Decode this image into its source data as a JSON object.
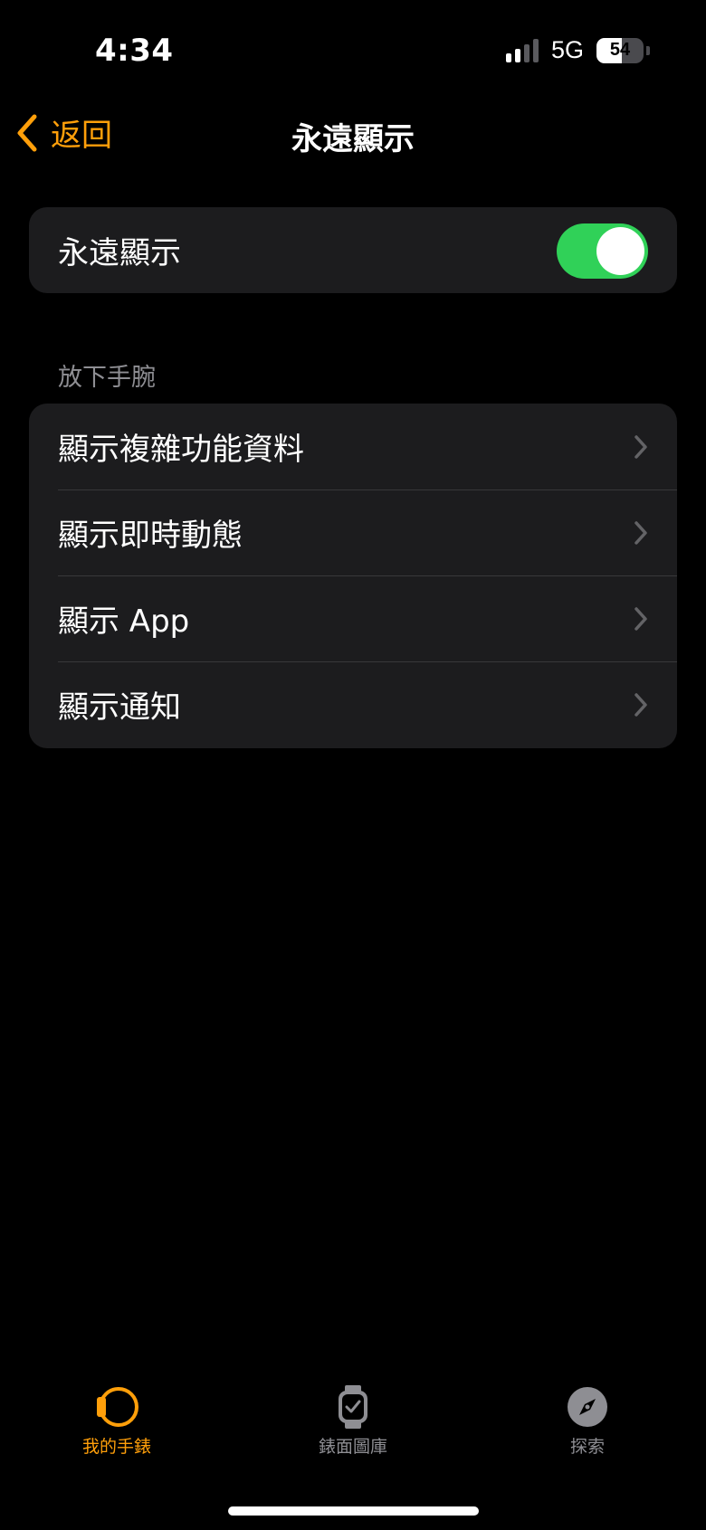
{
  "status_bar": {
    "time": "4:34",
    "network": "5G",
    "battery_percent": "54",
    "signal_bars_active": 2,
    "signal_bars_total": 4
  },
  "nav": {
    "back_label": "返回",
    "title": "永遠顯示"
  },
  "always_on": {
    "label": "永遠顯示",
    "enabled": true
  },
  "wrist_down_section": {
    "header": "放下手腕",
    "items": [
      {
        "label": "顯示複雜功能資料",
        "icon": "chevron-right-icon"
      },
      {
        "label": "顯示即時動態",
        "icon": "chevron-right-icon"
      },
      {
        "label": "顯示 App",
        "icon": "chevron-right-icon"
      },
      {
        "label": "顯示通知",
        "icon": "chevron-right-icon"
      }
    ]
  },
  "tab_bar": {
    "tabs": [
      {
        "label": "我的手錶",
        "icon": "watch-icon",
        "active": true
      },
      {
        "label": "錶面圖庫",
        "icon": "watch-face-gallery-icon",
        "active": false
      },
      {
        "label": "探索",
        "icon": "compass-icon",
        "active": false
      }
    ]
  },
  "colors": {
    "accent": "#ff9f0a",
    "toggle_on": "#30d158",
    "background": "#000000",
    "card": "#1c1c1e",
    "secondary_text": "#8e8e93"
  }
}
